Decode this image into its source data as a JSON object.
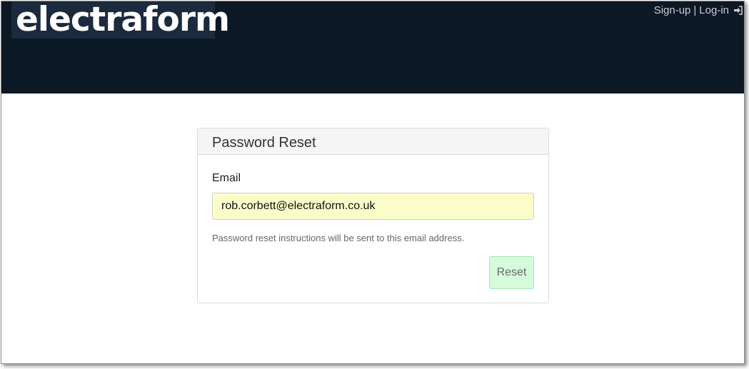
{
  "header": {
    "logo_text": "electraform",
    "signup_label": "Sign-up",
    "separator": "|",
    "login_label": "Log-in",
    "login_icon": "sign-in-icon"
  },
  "card": {
    "title": "Password Reset",
    "email_label": "Email",
    "email_value": "rob.corbett@electraform.co.uk",
    "help_text": "Password reset instructions will be sent to this email address.",
    "reset_label": "Reset"
  },
  "colors": {
    "header_bg": "#0d1825",
    "input_bg": "#fbfdc8",
    "button_bg": "#d6fbdc"
  }
}
